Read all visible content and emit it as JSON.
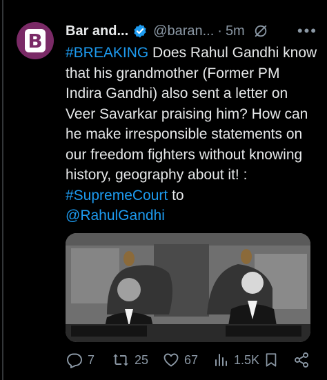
{
  "author": {
    "name": "Bar and...",
    "handle": "@baran...",
    "time": "5m",
    "avatar_icon": "bar-and-bench-logo",
    "avatar_letter": "B",
    "avatar_color": "#7a2a66"
  },
  "tweet": {
    "hashtag_breaking": "#BREAKING",
    "text_main": " Does Rahul Gandhi know that his grandmother (Former PM Indira Gandhi) also sent a letter on Veer Savarkar praising him? How can he make irresponsible statements on our freedom fighters without knowing history, geography about it! : ",
    "hashtag_court": "#SupremeCourt",
    "text_to": " to",
    "mention": "@RahulGandhi"
  },
  "media": {
    "alt": ""
  },
  "actions": {
    "replies": "7",
    "reposts": "25",
    "likes": "67",
    "views": "1.5K"
  },
  "colors": {
    "background": "#000000",
    "text": "#e7e9ea",
    "secondary": "#8b98a5",
    "link": "#1d9bf0",
    "verified": "#1d9bf0"
  }
}
